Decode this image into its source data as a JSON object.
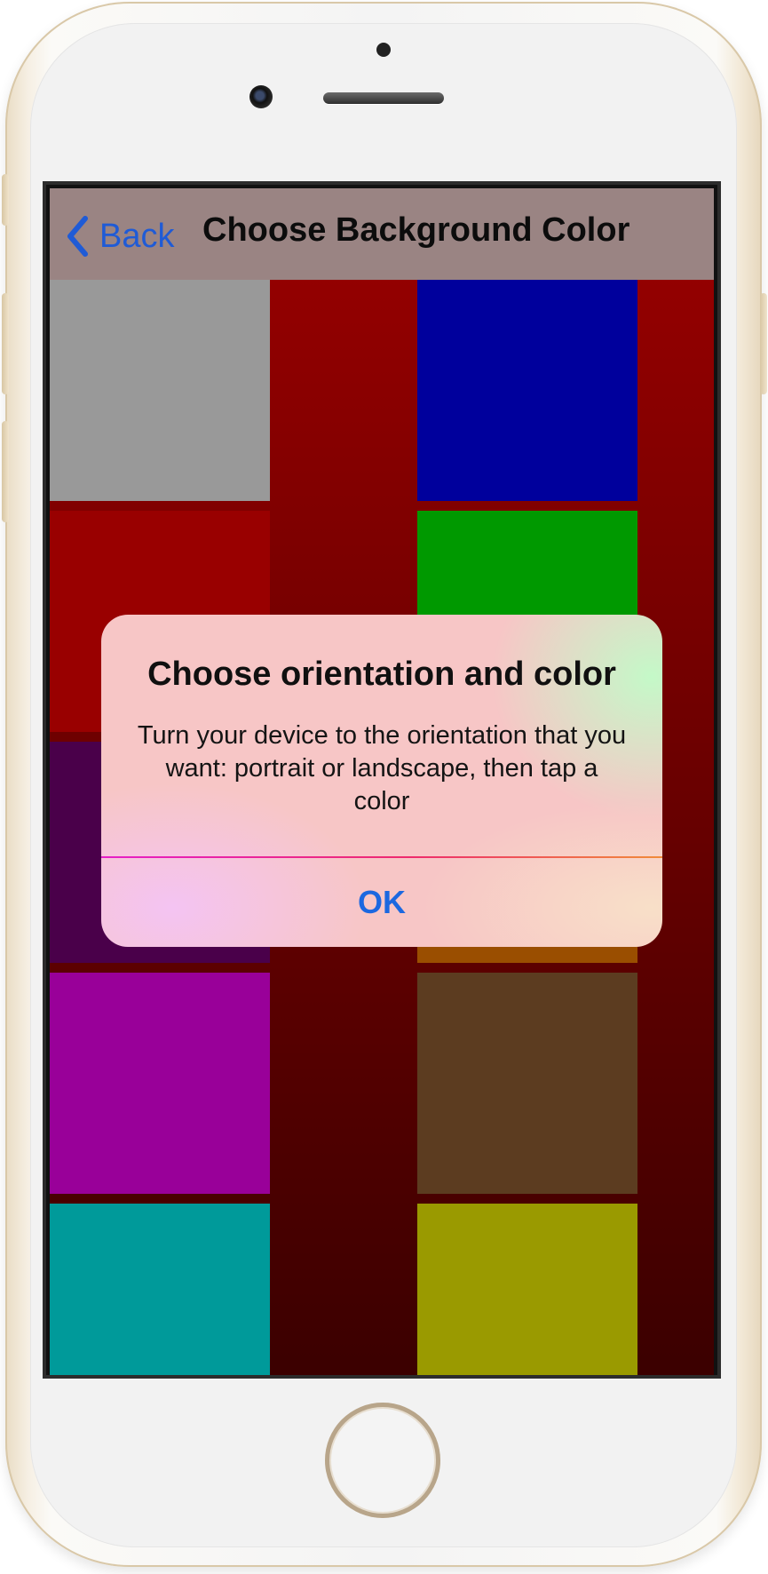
{
  "navbar": {
    "back_label": "Back",
    "title": "Choose Background Color"
  },
  "swatches": [
    {
      "name": "gray",
      "color": "#999999"
    },
    {
      "name": "blue",
      "color": "#00009c"
    },
    {
      "name": "red",
      "color": "#990000"
    },
    {
      "name": "green",
      "color": "#009900"
    },
    {
      "name": "dark-purple",
      "color": "#4a004a"
    },
    {
      "name": "orange",
      "color": "#9a4e00"
    },
    {
      "name": "magenta",
      "color": "#990099"
    },
    {
      "name": "brown",
      "color": "#5c3c20"
    },
    {
      "name": "teal",
      "color": "#009a9a"
    },
    {
      "name": "olive",
      "color": "#9a9a00"
    }
  ],
  "alert": {
    "title": "Choose orientation and color",
    "message": "Turn your device to the orientation that you want: portrait or landscape, then tap a color",
    "ok_label": "OK"
  },
  "icons": {
    "back": "chevron-left-icon"
  },
  "colors": {
    "navbar_bg": "#9a8483",
    "tint": "#1f5bd6",
    "alert_button": "#1c68e0"
  }
}
